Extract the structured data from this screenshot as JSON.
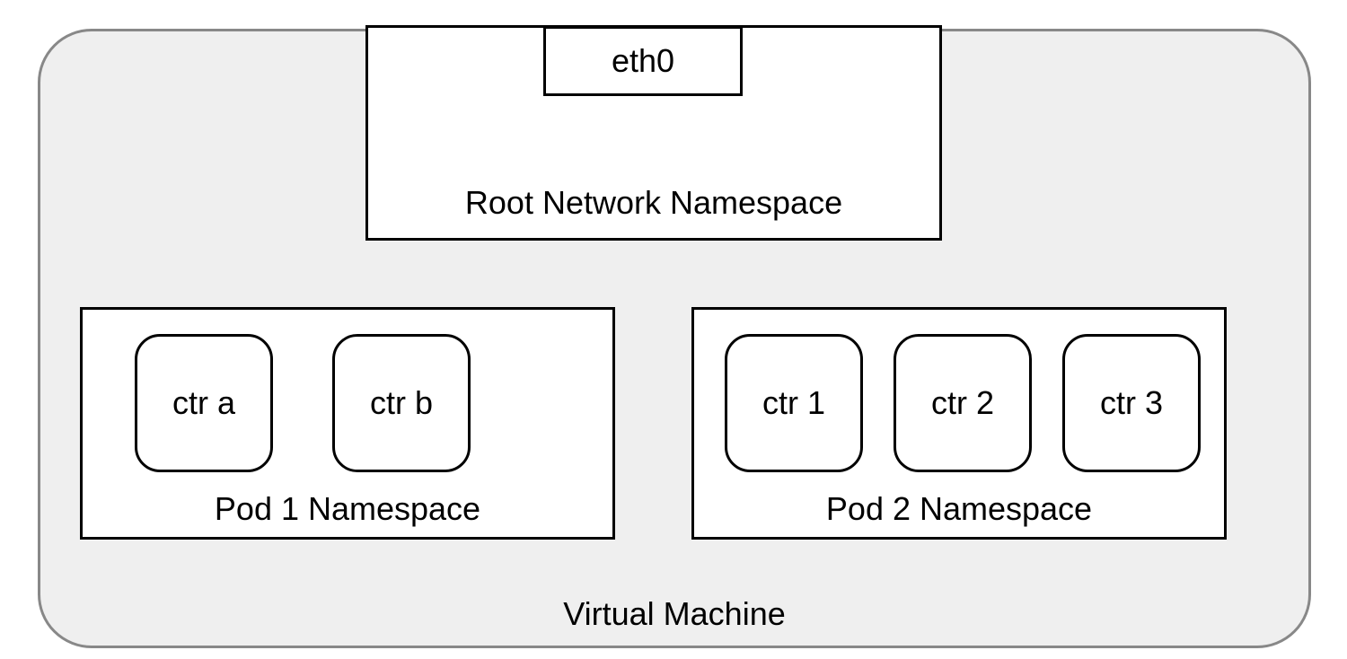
{
  "vm": {
    "label": "Virtual Machine"
  },
  "root_namespace": {
    "label": "Root Network Namespace",
    "interface": {
      "label": "eth0"
    }
  },
  "pods": [
    {
      "label": "Pod 1 Namespace",
      "containers": [
        {
          "label": "ctr a"
        },
        {
          "label": "ctr b"
        }
      ]
    },
    {
      "label": "Pod 2 Namespace",
      "containers": [
        {
          "label": "ctr 1"
        },
        {
          "label": "ctr 2"
        },
        {
          "label": "ctr 3"
        }
      ]
    }
  ]
}
